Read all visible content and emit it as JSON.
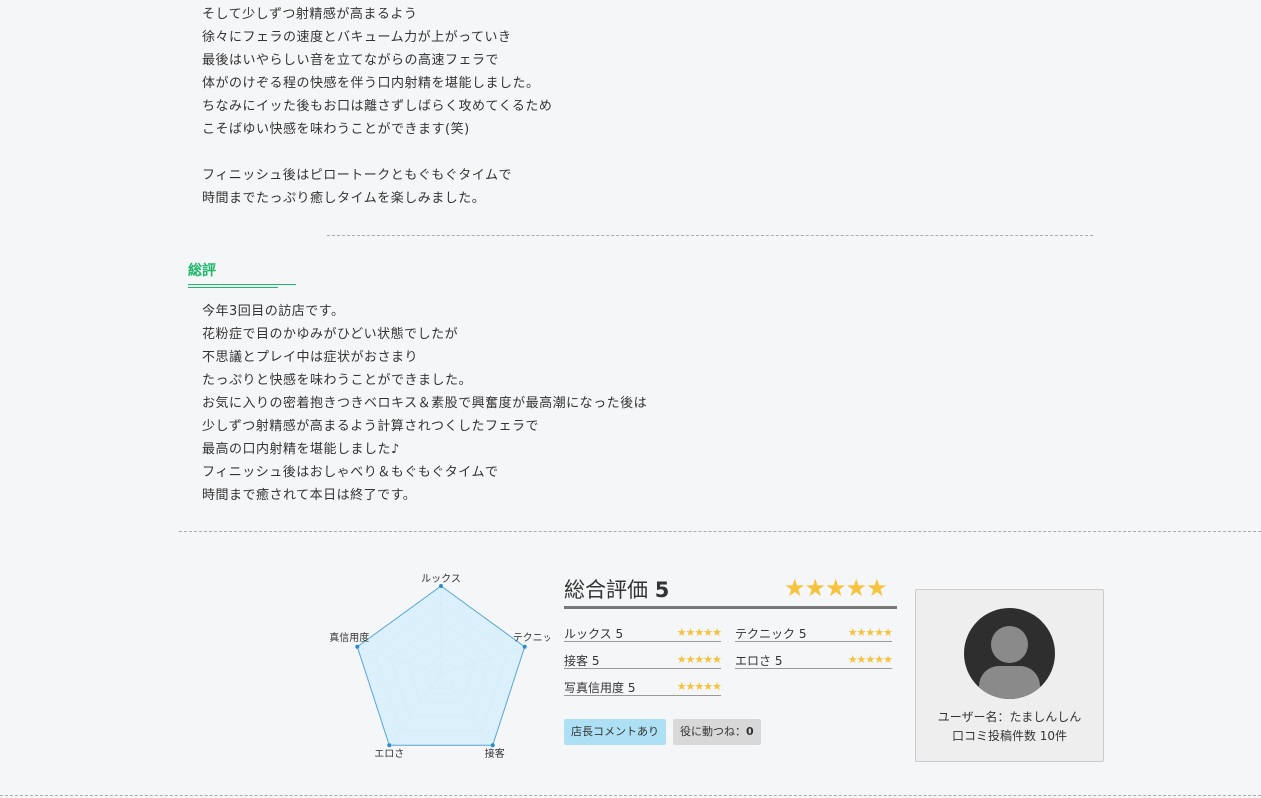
{
  "review_text": {
    "top_lines": [
      "そして少しずつ射精感が高まるよう",
      "徐々にフェラの速度とバキューム力が上がっていき",
      "最後はいやらしい音を立てながらの高速フェラで",
      "体がのけぞる程の快感を伴う口内射精を堪能しました。",
      "ちなみにイッた後もお口は離さずしばらく攻めてくるため",
      "こそばゆい快感を味わうことができます(笑)",
      "",
      "フィニッシュ後はピロートークともぐもぐタイムで",
      "時間までたっぷり癒しタイムを楽しみました。"
    ]
  },
  "summary": {
    "heading": "総評",
    "lines": [
      "今年3回目の訪店です。",
      "花粉症で目のかゆみがひどい状態でしたが",
      "不思議とプレイ中は症状がおさまり",
      "たっぷりと快感を味わうことができました。",
      "お気に入りの密着抱きつきベロキス＆素股で興奮度が最高潮になった後は",
      "少しずつ射精感が高まるよう計算されつくしたフェラで",
      "最高の口内射精を堪能しました♪",
      "フィニッシュ後はおしゃべり＆もぐもぐタイムで",
      "時間まで癒されて本日は終了です。"
    ]
  },
  "chart_data": {
    "type": "radar",
    "categories": [
      "ルックス",
      "テクニック",
      "接客",
      "エロさ",
      "写真信用度"
    ],
    "values": [
      5,
      5,
      5,
      5,
      5
    ],
    "range": [
      0,
      5
    ],
    "fill_color": "#d6effb",
    "stroke_color": "#5aa9d6"
  },
  "rating": {
    "overall_label": "総合評価",
    "overall_value": "5",
    "overall_stars": "★★★★★",
    "items": [
      {
        "label": "ルックス 5",
        "stars": "★★★★★"
      },
      {
        "label": "テクニック 5",
        "stars": "★★★★★"
      },
      {
        "label": "接客 5",
        "stars": "★★★★★"
      },
      {
        "label": "エロさ 5",
        "stars": "★★★★★"
      },
      {
        "label": "写真信用度 5",
        "stars": "★★★★★"
      }
    ],
    "star_color": "#f7c23d"
  },
  "badges": {
    "manager_comment": "店長コメントあり",
    "helpful_label": "役に動つね：",
    "helpful_count": "0"
  },
  "user": {
    "name_line": "ユーザー名：たましんしん",
    "posts_line": "口コミ投稿件数 10件"
  },
  "colors": {
    "accent_green": "#1fb86a",
    "badge_blue": "#aee0f5",
    "badge_gray": "#d8d8d8"
  }
}
